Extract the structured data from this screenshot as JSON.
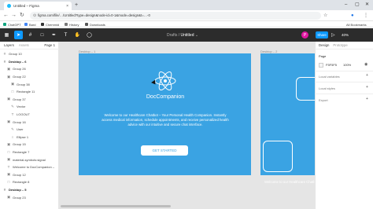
{
  "browser": {
    "tab_title": "Untitled – Figma",
    "tab_close": "×",
    "new_tab": "+",
    "minimize": "–",
    "maximize": "▢",
    "close": "✕",
    "back": "←",
    "forward": "→",
    "reload": "↻",
    "url": "figma.com/file/…/Untitled?type=design&node-id=0-1&mode=design&t=…-0",
    "lock": "⊙",
    "star": "☆",
    "profile": "●",
    "menu": "⋮",
    "bookmarks": [
      {
        "label": "ChatGPT",
        "color": "#10a37f"
      },
      {
        "label": "Bard",
        "color": "#4285f4"
      },
      {
        "label": "Chemmid",
        "color": "#333333"
      },
      {
        "label": "History",
        "color": "#777777"
      },
      {
        "label": "Downloads",
        "color": "#555555"
      }
    ],
    "all_bookmarks": "All Bookmarks"
  },
  "figma": {
    "tools": [
      {
        "name": "figma-menu",
        "glyph": "▦"
      },
      {
        "name": "move-tool",
        "glyph": "➤"
      },
      {
        "name": "frame-tool",
        "glyph": "#"
      },
      {
        "name": "rectangle-tool",
        "glyph": "□"
      },
      {
        "name": "pen-tool",
        "glyph": "✒"
      },
      {
        "name": "text-tool",
        "glyph": "T"
      },
      {
        "name": "hand-tool",
        "glyph": "✋"
      },
      {
        "name": "comment-tool",
        "glyph": "◯"
      }
    ],
    "drafts": "Drafts",
    "separator": "/",
    "file_name": "Untitled",
    "caret": "⌄",
    "avatar_letter": "P",
    "share_label": "Share",
    "play": "▷",
    "zoom": "40%"
  },
  "layers_panel": {
    "tab_layers": "Layers",
    "tab_assets": "Assets",
    "page_label": "Page 1",
    "layers": [
      {
        "icon": "#",
        "label": "Group 10",
        "indent": 0,
        "bold": false
      },
      {
        "icon": "#",
        "label": "Desktop – 6",
        "indent": 0,
        "bold": true
      },
      {
        "icon": "▣",
        "label": "Group 26",
        "indent": 1,
        "bold": false
      },
      {
        "icon": "▣",
        "label": "Group 22",
        "indent": 1,
        "bold": false
      },
      {
        "icon": "▣",
        "label": "Group 38",
        "indent": 2,
        "bold": false
      },
      {
        "icon": "□",
        "label": "Rectangle 11",
        "indent": 2,
        "bold": false
      },
      {
        "icon": "▣",
        "label": "Group 37",
        "indent": 1,
        "bold": false
      },
      {
        "icon": "✎",
        "label": "Vector",
        "indent": 2,
        "bold": false
      },
      {
        "icon": "T",
        "label": "LOGOUT",
        "indent": 2,
        "bold": false
      },
      {
        "icon": "▣",
        "label": "Group 16",
        "indent": 1,
        "bold": false
      },
      {
        "icon": "✎",
        "label": "User",
        "indent": 2,
        "bold": false
      },
      {
        "icon": "○",
        "label": "Ellipse 1",
        "indent": 2,
        "bold": false
      },
      {
        "icon": "▣",
        "label": "Group 15",
        "indent": 1,
        "bold": false
      },
      {
        "icon": "□",
        "label": "Rectangle 7",
        "indent": 1,
        "bold": false
      },
      {
        "icon": "▣",
        "label": "material-symbols:signal",
        "indent": 1,
        "bold": false
      },
      {
        "icon": "T",
        "label": "Welcome to DocCompanion –",
        "indent": 1,
        "bold": false
      },
      {
        "icon": "▣",
        "label": "Group 12",
        "indent": 1,
        "bold": false
      },
      {
        "icon": "□",
        "label": "Rectangle 8",
        "indent": 1,
        "bold": false
      },
      {
        "icon": "#",
        "label": "Desktop – 5",
        "indent": 0,
        "bold": true
      },
      {
        "icon": "▣",
        "label": "Group 23",
        "indent": 1,
        "bold": false
      }
    ]
  },
  "canvas": {
    "frame1_label": "Desktop – 1",
    "frame2_label": "Desktop – 2",
    "brand": "DocCompanion",
    "welcome": "Welcome to our Healthcare Chatbot – Your Personal Health Companion. Instantly access medical information, schedule appointments, and receive personalized health advice with our intuitive and secure chat interface.",
    "cta": "GET STARTED",
    "frame2_text": "Welcome to our Healthcare Chatbot – Instantly access medical info personalized health advice w",
    "frame_color": "#3aa3e3"
  },
  "design_panel": {
    "tab_design": "Design",
    "tab_prototype": "Prototype",
    "page_heading": "Page",
    "page_color": "F5F5F5",
    "page_opacity": "100%",
    "eye": "◉",
    "plus": "+",
    "local_variables": "Local variables",
    "local_styles": "Local styles",
    "export": "Export"
  }
}
